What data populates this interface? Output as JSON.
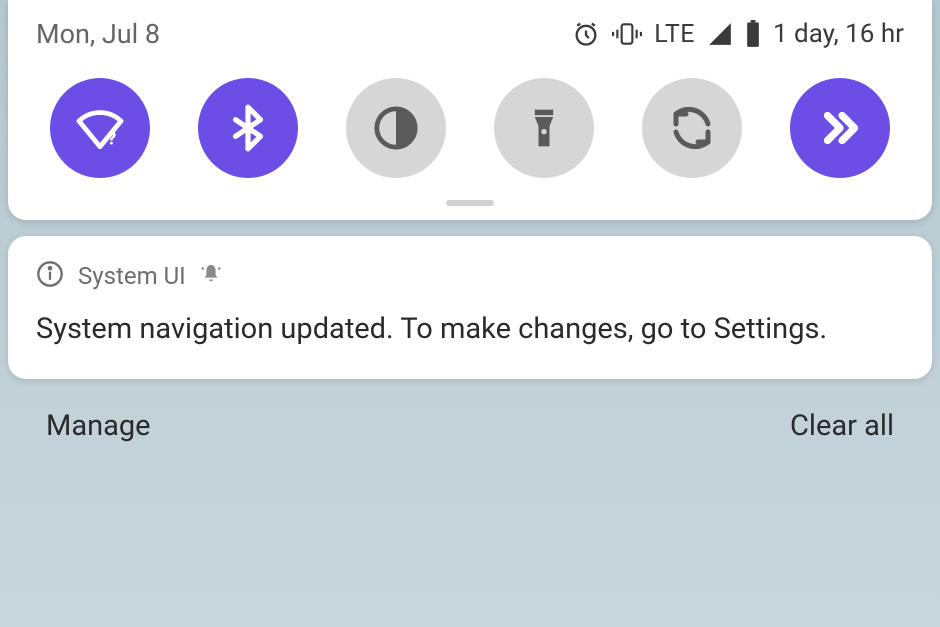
{
  "status": {
    "date": "Mon, Jul 8",
    "lte": "LTE",
    "battery_text": "1 day, 16 hr"
  },
  "tiles": {
    "wifi_active": true,
    "bluetooth_active": true,
    "contrast_active": false,
    "flashlight_active": false,
    "rotate_active": false,
    "next_active": true
  },
  "notification": {
    "app": "System UI",
    "body": "System navigation updated. To make changes, go to Settings."
  },
  "footer": {
    "manage": "Manage",
    "clear_all": "Clear all"
  },
  "colors": {
    "accent": "#6c4de6",
    "inactive": "#d6d6d6"
  }
}
